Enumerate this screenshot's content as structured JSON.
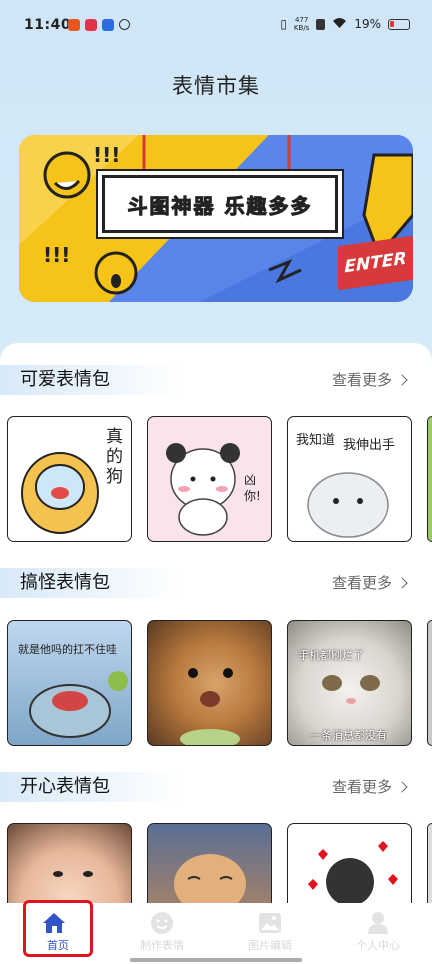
{
  "status": {
    "time": "11:40",
    "speed_value": "477",
    "speed_unit": "KB/s",
    "battery": "19%"
  },
  "page_title": "表情市集",
  "banner": {
    "headline": "斗图神器 乐趣多多",
    "exclaim1": "!!!",
    "exclaim2": "!!!",
    "enter_label": "ENTER"
  },
  "sections": [
    {
      "title": "可爱表情包",
      "more": "查看更多"
    },
    {
      "title": "搞怪表情包",
      "more": "查看更多"
    },
    {
      "title": "开心表情包",
      "more": "查看更多"
    }
  ],
  "captions": {
    "cute1": "真的狗",
    "cute2": "凶你!",
    "cute3a": "我知道",
    "cute3b": "我伸出手",
    "funny1": "就是他吗的扛不住哇",
    "funny3a": "手机都刷烂了",
    "funny3b": "一条消息都没有"
  },
  "tabbar": [
    {
      "label": "首页",
      "active": true
    },
    {
      "label": "制作表情",
      "active": false
    },
    {
      "label": "图片编辑",
      "active": false
    },
    {
      "label": "个人中心",
      "active": false
    }
  ],
  "colors": {
    "accent": "#3354c8",
    "highlight": "#e0141e",
    "banner_blue": "#4b77e0",
    "banner_yellow": "#f6c318"
  }
}
